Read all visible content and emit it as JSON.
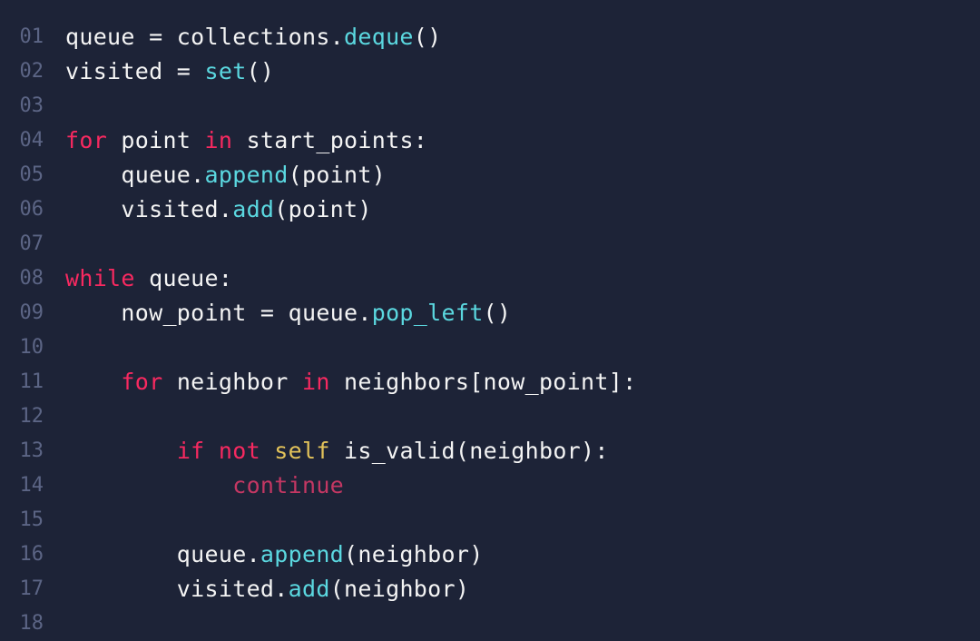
{
  "editor": {
    "line_numbers": [
      "01",
      "02",
      "03",
      "04",
      "05",
      "06",
      "07",
      "08",
      "09",
      "10",
      "11",
      "12",
      "13",
      "14",
      "15",
      "16",
      "17",
      "18"
    ],
    "lines": [
      {
        "tokens": [
          {
            "t": "queue = collections.",
            "c": "pl"
          },
          {
            "t": "deque",
            "c": "fn"
          },
          {
            "t": "()",
            "c": "pl"
          }
        ]
      },
      {
        "tokens": [
          {
            "t": "visited = ",
            "c": "pl"
          },
          {
            "t": "set",
            "c": "fn"
          },
          {
            "t": "()",
            "c": "pl"
          }
        ]
      },
      {
        "tokens": []
      },
      {
        "tokens": [
          {
            "t": "for",
            "c": "kw"
          },
          {
            "t": " point ",
            "c": "pl"
          },
          {
            "t": "in",
            "c": "kw"
          },
          {
            "t": " start_points:",
            "c": "pl"
          }
        ]
      },
      {
        "tokens": [
          {
            "t": "    queue.",
            "c": "pl"
          },
          {
            "t": "append",
            "c": "fn"
          },
          {
            "t": "(point)",
            "c": "pl"
          }
        ]
      },
      {
        "tokens": [
          {
            "t": "    visited.",
            "c": "pl"
          },
          {
            "t": "add",
            "c": "fn"
          },
          {
            "t": "(point)",
            "c": "pl"
          }
        ]
      },
      {
        "tokens": []
      },
      {
        "tokens": [
          {
            "t": "while",
            "c": "kw"
          },
          {
            "t": " queue:",
            "c": "pl"
          }
        ]
      },
      {
        "tokens": [
          {
            "t": "    now_point = queue.",
            "c": "pl"
          },
          {
            "t": "pop_left",
            "c": "fn"
          },
          {
            "t": "()",
            "c": "pl"
          }
        ]
      },
      {
        "tokens": []
      },
      {
        "tokens": [
          {
            "t": "    ",
            "c": "pl"
          },
          {
            "t": "for",
            "c": "kw"
          },
          {
            "t": " neighbor ",
            "c": "pl"
          },
          {
            "t": "in",
            "c": "kw"
          },
          {
            "t": " neighbors[now_point]:",
            "c": "pl"
          }
        ]
      },
      {
        "tokens": []
      },
      {
        "tokens": [
          {
            "t": "        ",
            "c": "pl"
          },
          {
            "t": "if",
            "c": "kw"
          },
          {
            "t": " ",
            "c": "pl"
          },
          {
            "t": "not",
            "c": "kw"
          },
          {
            "t": " ",
            "c": "pl"
          },
          {
            "t": "self",
            "c": "slf"
          },
          {
            "t": " is_valid(neighbor):",
            "c": "pl"
          }
        ]
      },
      {
        "tokens": [
          {
            "t": "            ",
            "c": "pl"
          },
          {
            "t": "continue",
            "c": "kw2"
          }
        ]
      },
      {
        "tokens": []
      },
      {
        "tokens": [
          {
            "t": "        queue.",
            "c": "pl"
          },
          {
            "t": "append",
            "c": "fn"
          },
          {
            "t": "(neighbor)",
            "c": "pl"
          }
        ]
      },
      {
        "tokens": [
          {
            "t": "        visited.",
            "c": "pl"
          },
          {
            "t": "add",
            "c": "fn"
          },
          {
            "t": "(neighbor)",
            "c": "pl"
          }
        ]
      },
      {
        "tokens": []
      }
    ]
  }
}
